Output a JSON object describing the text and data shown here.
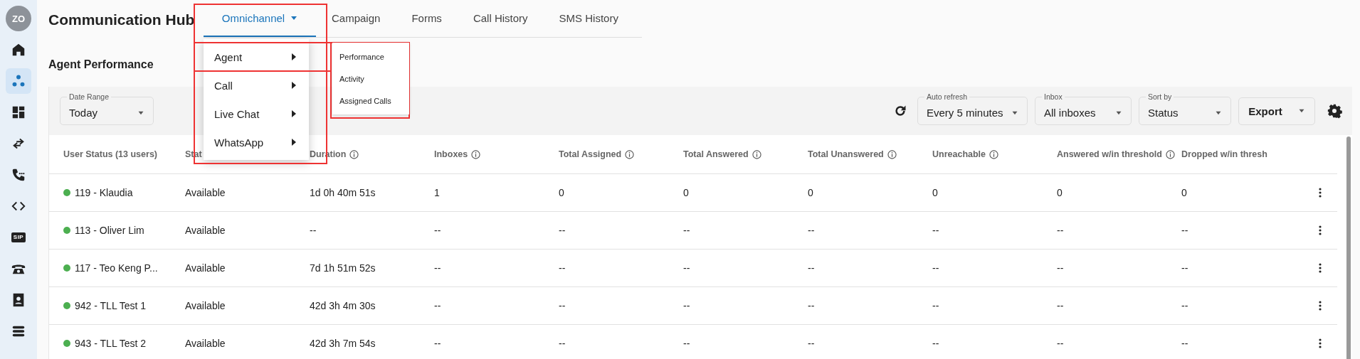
{
  "sidebar": {
    "avatar": "ZO",
    "items": [
      {
        "kind": "home",
        "selected": false
      },
      {
        "kind": "dots",
        "selected": true
      },
      {
        "kind": "dashboard",
        "selected": false
      },
      {
        "kind": "arrows",
        "selected": false
      },
      {
        "kind": "phone",
        "selected": false
      },
      {
        "kind": "code",
        "selected": false
      },
      {
        "kind": "badge",
        "label": "SIP",
        "selected": false
      },
      {
        "kind": "telephone",
        "selected": false
      },
      {
        "kind": "contact",
        "selected": false
      },
      {
        "kind": "stack",
        "selected": false
      }
    ]
  },
  "header": {
    "title": "Communication Hub"
  },
  "tabs": [
    {
      "label": "Omnichannel",
      "selected": true,
      "expanded": true,
      "highlight": true
    },
    {
      "label": "Campaign",
      "selected": false
    },
    {
      "label": "Forms",
      "selected": false
    },
    {
      "label": "Call History",
      "selected": false
    },
    {
      "label": "SMS History",
      "selected": false
    }
  ],
  "menu": {
    "items": [
      {
        "label": "Agent",
        "highlight": true,
        "submenu": {
          "highlight": true,
          "items": [
            "Performance",
            "Activity",
            "Assigned Calls"
          ]
        }
      },
      {
        "label": "Call"
      },
      {
        "label": "Live Chat"
      },
      {
        "label": "WhatsApp"
      }
    ]
  },
  "page_title": "Agent Performance",
  "filters": {
    "date_range": {
      "label": "Date Range",
      "value": "Today"
    },
    "auto_refresh": {
      "label": "Auto refresh",
      "value": "Every 5 minutes"
    },
    "inbox": {
      "label": "Inbox",
      "value": "All inboxes"
    },
    "sort_by": {
      "label": "Sort by",
      "value": "Status"
    },
    "export": "Export"
  },
  "table": {
    "columns": [
      {
        "label": "User Status (13 users)",
        "info": false
      },
      {
        "label": "Stat",
        "info": false
      },
      {
        "label": "Duration",
        "info": true
      },
      {
        "label": "Inboxes",
        "info": true
      },
      {
        "label": "Total Assigned",
        "info": true
      },
      {
        "label": "Total Answered",
        "info": true
      },
      {
        "label": "Total Unanswered",
        "info": true
      },
      {
        "label": "Unreachable",
        "info": true
      },
      {
        "label": "Answered w/in threshold",
        "info": true
      },
      {
        "label": "Dropped w/in thresh",
        "info": false
      }
    ],
    "rows": [
      {
        "color": "#4caf50",
        "cells": [
          "119 - Klaudia",
          "Available",
          "1d 0h 40m 51s",
          "1",
          "0",
          "0",
          "0",
          "0",
          "0",
          "0"
        ]
      },
      {
        "color": "#4caf50",
        "cells": [
          "113 - Oliver Lim",
          "Available",
          "--",
          "--",
          "--",
          "--",
          "--",
          "--",
          "--",
          "--"
        ]
      },
      {
        "color": "#4caf50",
        "cells": [
          "117 - Teo Keng P...",
          "Available",
          "7d 1h 51m 52s",
          "--",
          "--",
          "--",
          "--",
          "--",
          "--",
          "--"
        ]
      },
      {
        "color": "#4caf50",
        "cells": [
          "942 - TLL Test 1",
          "Available",
          "42d 3h 4m 30s",
          "--",
          "--",
          "--",
          "--",
          "--",
          "--",
          "--"
        ]
      },
      {
        "color": "#4caf50",
        "cells": [
          "943 - TLL Test 2",
          "Available",
          "42d 3h 7m 54s",
          "--",
          "--",
          "--",
          "--",
          "--",
          "--",
          "--"
        ]
      }
    ]
  }
}
